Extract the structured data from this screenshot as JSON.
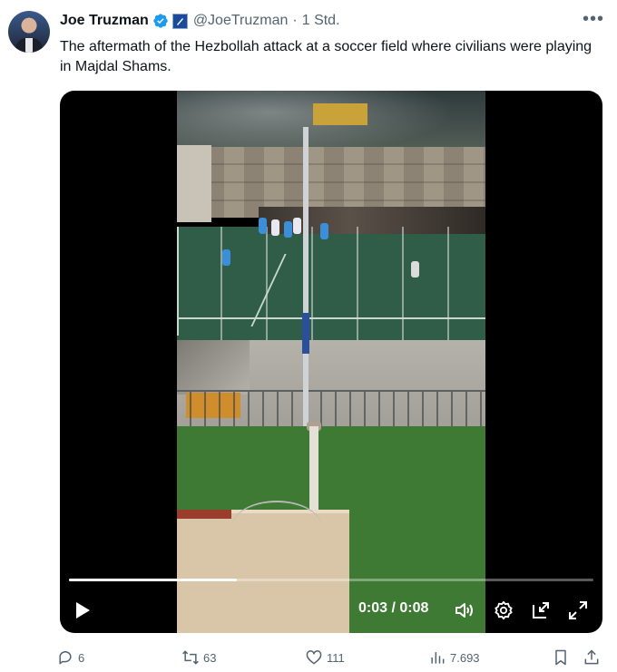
{
  "author": {
    "name": "Joe Truzman",
    "handle": "@JoeTruzman",
    "separator": "·",
    "time": "1 Std."
  },
  "tweet": {
    "text": "The aftermath of the Hezbollah attack at a soccer field where civilians were playing in Majdal Shams."
  },
  "video": {
    "timecode": "0:03 / 0:08",
    "progress_fraction": 0.32
  },
  "actions": {
    "replies": "6",
    "reposts": "63",
    "likes": "111",
    "views": "7.693"
  },
  "colors": {
    "verified": "#1d9bf0",
    "text_secondary": "#536471",
    "text_primary": "#0f1419"
  },
  "icons": [
    "verified-badge-icon",
    "affiliate-badge-icon",
    "more-icon",
    "play-icon",
    "volume-icon",
    "settings-icon",
    "pip-icon",
    "fullscreen-icon",
    "reply-icon",
    "repost-icon",
    "like-icon",
    "views-icon",
    "bookmark-icon",
    "share-icon"
  ]
}
